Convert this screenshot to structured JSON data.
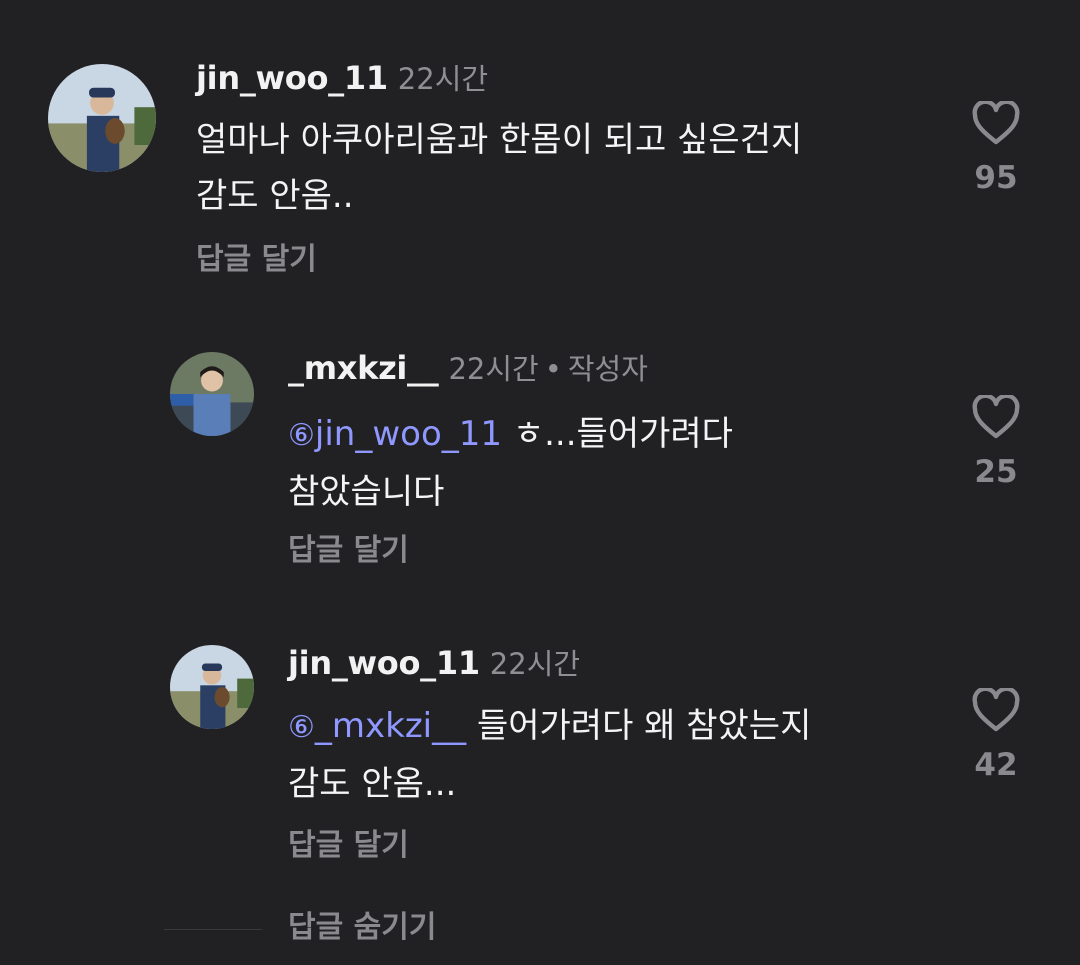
{
  "comments": [
    {
      "username": "jin_woo_11",
      "time": "22시간",
      "lines": [
        "얼마나 아쿠아리움과 한몸이 되고 싶은건지",
        "감도 안옴.."
      ],
      "reply_label": "답글 달기",
      "likes": "95"
    },
    {
      "username": "_mxkzi__",
      "time": "22시간",
      "separator": "•",
      "author_tag": "작성자",
      "mention_icon": "⑥",
      "mention": "jin_woo_11",
      "line1_rest": " ㅎ...들어가려다",
      "line2": "참았습니다",
      "reply_label": "답글 달기",
      "likes": "25"
    },
    {
      "username": "jin_woo_11",
      "time": "22시간",
      "mention_icon": "⑥",
      "mention": "_mxkzi__",
      "line1_rest": " 들어가려다 왜 참았는지",
      "line2": "감도 안옴...",
      "reply_label": "답글 달기",
      "likes": "42"
    }
  ],
  "hide_replies_label": "답글 숨기기",
  "colors": {
    "background": "#212124",
    "mention": "#8f98ff",
    "muted": "#8e8e93"
  },
  "icons": {
    "like": "heart-icon",
    "mention": "threads-mention-icon"
  }
}
